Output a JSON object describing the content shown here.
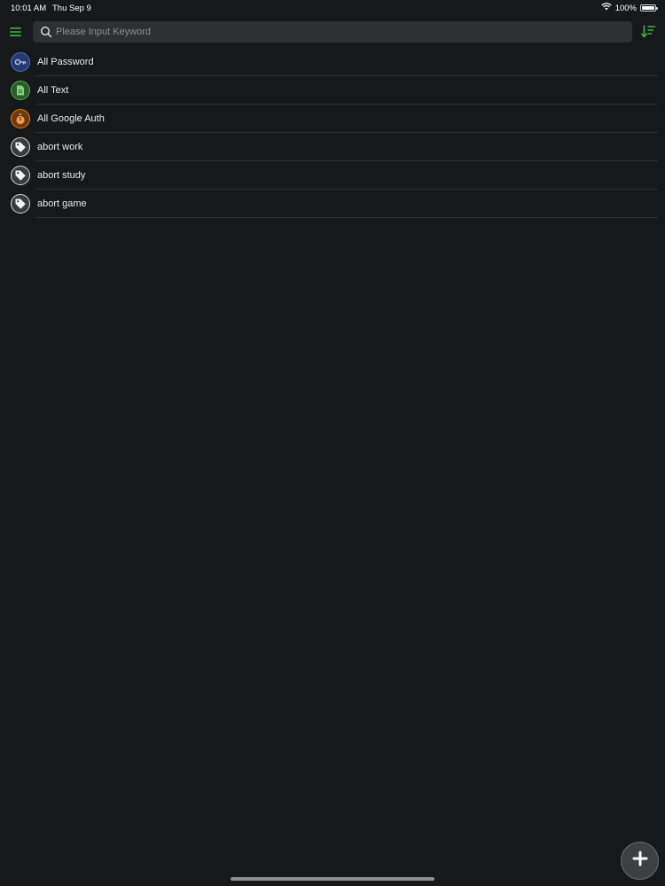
{
  "status_bar": {
    "time": "10:01 AM",
    "date": "Thu Sep 9",
    "battery": "100%",
    "wifi_icon": "wifi-icon",
    "battery_icon": "battery-icon"
  },
  "toolbar": {
    "menu_icon": "hamburger-menu-icon",
    "search_placeholder": "Please Input Keyword",
    "search_value": "",
    "search_icon": "search-icon",
    "sort_icon": "sort-icon"
  },
  "colors": {
    "background": "#17181a",
    "accent_green": "#4cae4c",
    "password_blue": "#4a6fd6",
    "text_green": "#4cae4c",
    "auth_orange": "#e57a1f",
    "tag_grey": "#d8d8d8"
  },
  "list": {
    "items": [
      {
        "label": "All Password",
        "icon": "key-icon"
      },
      {
        "label": "All Text",
        "icon": "document-icon"
      },
      {
        "label": "All Google Auth",
        "icon": "timer-icon"
      },
      {
        "label": "abort work",
        "icon": "tag-icon"
      },
      {
        "label": "abort study",
        "icon": "tag-icon"
      },
      {
        "label": "abort game",
        "icon": "tag-icon"
      }
    ]
  },
  "fab": {
    "icon": "plus-icon"
  }
}
